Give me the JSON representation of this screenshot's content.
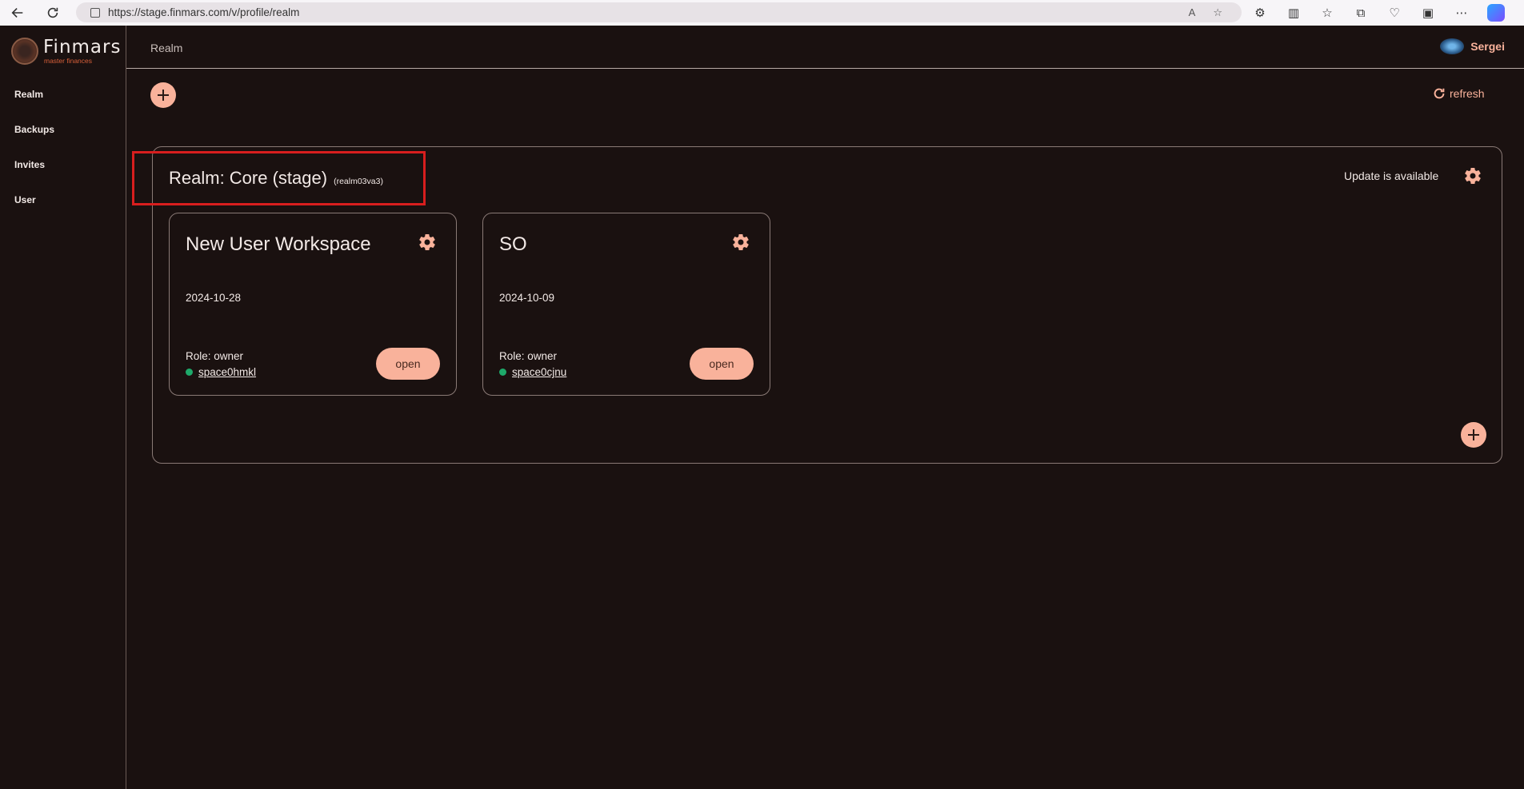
{
  "browser": {
    "url": "https://stage.finmars.com/v/profile/realm",
    "read_aloud_icon": "A",
    "icons": [
      "back-icon",
      "reload-icon",
      "lock-icon",
      "read-aloud-icon",
      "favorite-star-icon",
      "extensions-icon",
      "split-screen-icon",
      "favorites-icon",
      "collections-icon",
      "browser-essentials-icon",
      "screenshot-icon",
      "more-icon",
      "copilot-icon"
    ]
  },
  "app": {
    "brand": "Finmars",
    "tagline": "master finances"
  },
  "sidebar": {
    "items": [
      {
        "label": "Realm"
      },
      {
        "label": "Backups"
      },
      {
        "label": "Invites"
      },
      {
        "label": "User"
      }
    ]
  },
  "header": {
    "breadcrumb": "Realm",
    "user_name": "Sergei"
  },
  "toolbar": {
    "refresh_label": "refresh"
  },
  "realm": {
    "title": "Realm: Core (stage)",
    "id": "(realm03va3)",
    "update_status": "Update is available"
  },
  "workspaces": [
    {
      "title": "New User Workspace",
      "date": "2024-10-28",
      "role": "Role: owner",
      "space": "space0hmkl",
      "status_color": "#1ea96a",
      "open_label": "open"
    },
    {
      "title": "SO",
      "date": "2024-10-09",
      "role": "Role: owner",
      "space": "space0cjnu",
      "status_color": "#1ea96a",
      "open_label": "open"
    }
  ],
  "colors": {
    "background": "#1a1110",
    "accent": "#f9b29b",
    "highlight": "#d81e1e"
  }
}
